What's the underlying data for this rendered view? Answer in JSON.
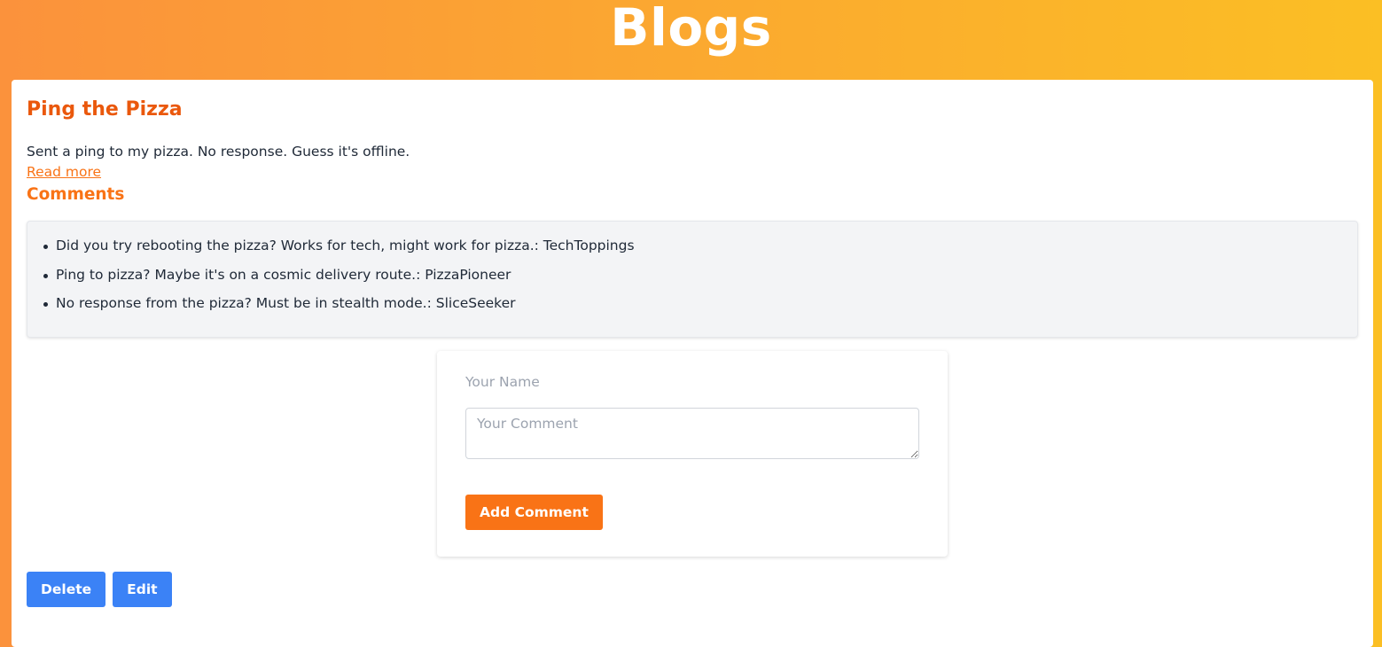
{
  "header": {
    "title": "Blogs"
  },
  "post": {
    "title": "Ping the Pizza",
    "excerpt": "Sent a ping to my pizza. No response. Guess it's offline.",
    "read_more": "Read more",
    "comments_heading": "Comments",
    "comments": [
      {
        "text": "Did you try rebooting the pizza? Works for tech, might work for pizza.: TechToppings"
      },
      {
        "text": "Ping to pizza? Maybe it's on a cosmic delivery route.: PizzaPioneer"
      },
      {
        "text": "No response from the pizza? Must be in stealth mode.: SliceSeeker"
      }
    ]
  },
  "form": {
    "name_placeholder": "Your Name",
    "comment_placeholder": "Your Comment",
    "submit_label": "Add Comment"
  },
  "actions": {
    "delete_label": "Delete",
    "edit_label": "Edit"
  },
  "colors": {
    "gradient_start": "#fb923c",
    "gradient_end": "#fbbf24",
    "accent_orange": "#f97316",
    "action_blue": "#3b82f6"
  }
}
